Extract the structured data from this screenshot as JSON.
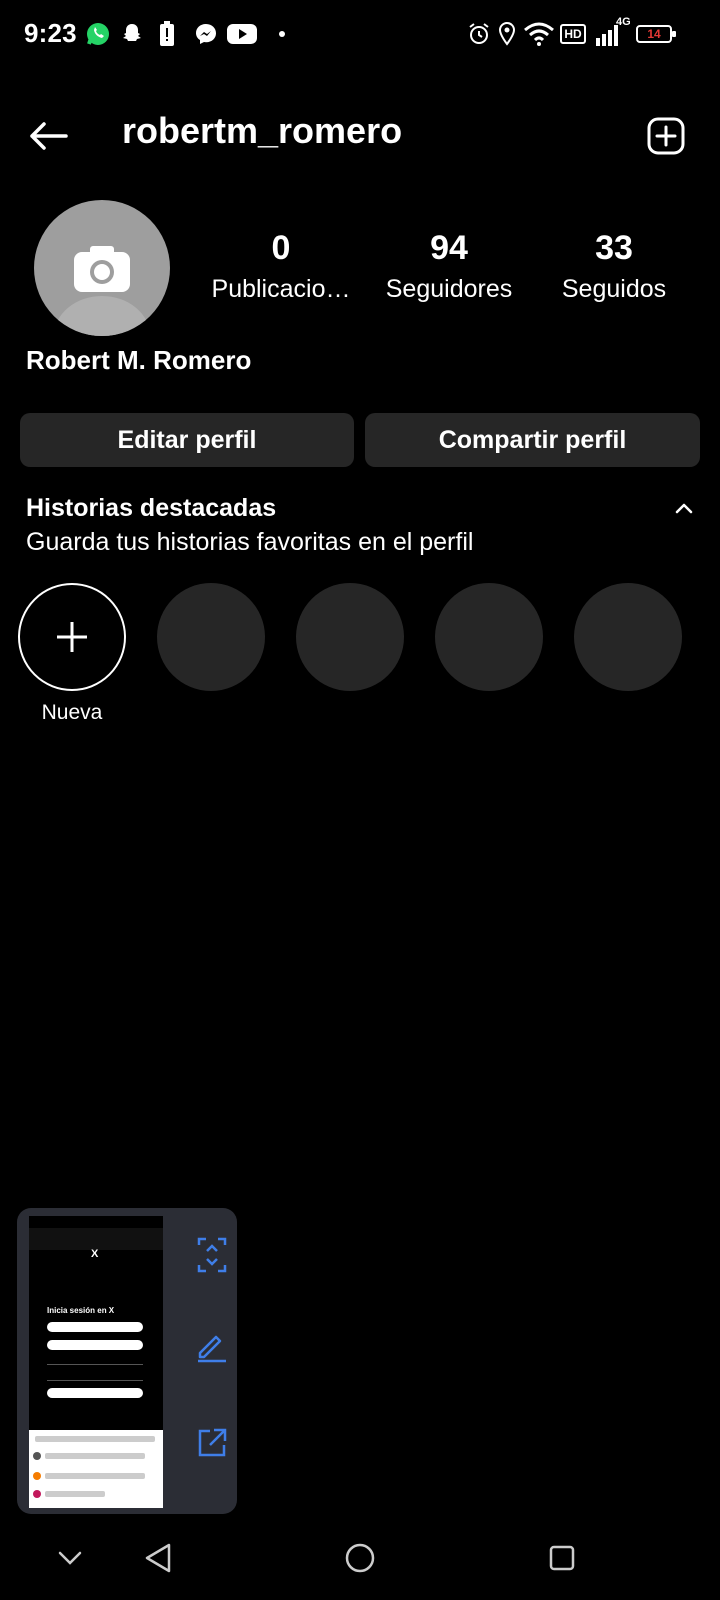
{
  "status_bar": {
    "time": "9:23",
    "battery": "14",
    "network": "4G",
    "hd": "HD",
    "icons": [
      "whatsapp-icon",
      "snapchat-icon",
      "battery-alert-icon",
      "messenger-icon",
      "youtube-icon",
      "dot-icon",
      "alarm-icon",
      "location-icon",
      "wifi-icon",
      "hd-icon",
      "signal-icon",
      "battery-icon"
    ]
  },
  "header": {
    "username": "robertm_romero"
  },
  "profile": {
    "full_name": "Robert M. Romero",
    "stats": {
      "posts": {
        "value": "0",
        "label": "Publicacio…"
      },
      "followers": {
        "value": "94",
        "label": "Seguidores"
      },
      "following": {
        "value": "33",
        "label": "Seguidos"
      }
    },
    "buttons": {
      "edit": "Editar perfil",
      "share": "Compartir perfil"
    }
  },
  "highlights": {
    "title": "Historias destacadas",
    "subtitle": "Guarda tus historias favoritas en el perfil",
    "new_label": "Nueva",
    "placeholder_count": 4
  },
  "screenshot_preview": {
    "thumb_title": "Inicia sesión en X",
    "thumb_logo": "X",
    "actions": [
      "scroll-capture-icon",
      "edit-pen-icon",
      "share-icon"
    ]
  },
  "nav_bar": [
    "collapse-icon",
    "back-triangle-icon",
    "home-circle-icon",
    "recents-square-icon"
  ],
  "colors": {
    "background": "#000000",
    "button": "#262626",
    "preview_panel": "#2b2d35",
    "accent_blue": "#3f7ee8",
    "avatar": "#9e9e9e"
  }
}
